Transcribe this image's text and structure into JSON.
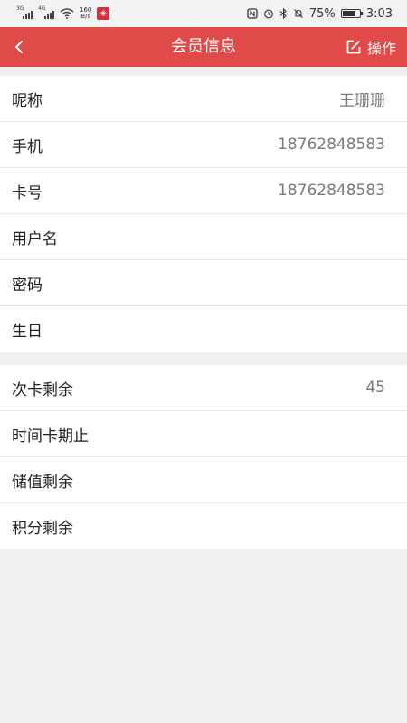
{
  "status_bar": {
    "network_1": "3G",
    "network_2": "4G",
    "speed_value": "160",
    "speed_unit": "B/s",
    "app_icon": "unionpay-icon",
    "icons": [
      "nfc-icon",
      "alarm-icon",
      "bluetooth-icon",
      "mute-icon"
    ],
    "battery_percent": "75%",
    "battery_level": 0.75,
    "time": "3:03"
  },
  "nav": {
    "back_icon": "back-chevron-icon",
    "title": "会员信息",
    "action_icon": "edit-icon",
    "action_label": "操作"
  },
  "colors": {
    "nav_background": "#e04a48",
    "page_background": "#f0f0f0",
    "value_text": "#7a7a7a"
  },
  "member_info": [
    {
      "label": "昵称",
      "value": "王珊珊"
    },
    {
      "label": "手机",
      "value": "18762848583"
    },
    {
      "label": "卡号",
      "value": "18762848583"
    },
    {
      "label": "用户名",
      "value": ""
    },
    {
      "label": "密码",
      "value": ""
    },
    {
      "label": "生日",
      "value": ""
    }
  ],
  "balances": [
    {
      "label": "次卡剩余",
      "value": "45"
    },
    {
      "label": "时间卡期止",
      "value": ""
    },
    {
      "label": "储值剩余",
      "value": ""
    },
    {
      "label": "积分剩余",
      "value": ""
    }
  ]
}
